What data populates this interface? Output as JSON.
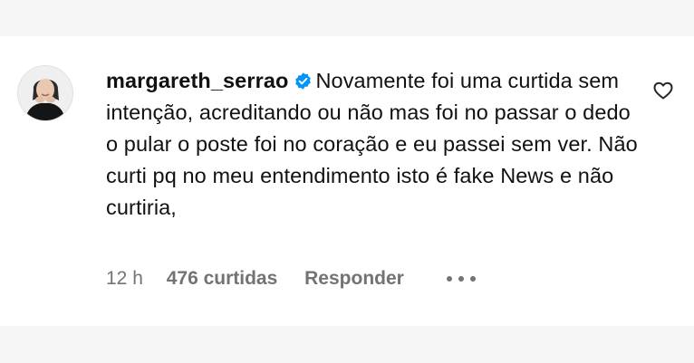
{
  "comment": {
    "username": "margareth_serrao",
    "verified": true,
    "text": "Novamente foi uma curtida sem intenção, acreditando ou não mas foi no passar o dedo o pular o poste foi no coração e eu passei sem ver. Não curti pq no meu entendimento isto é fake News e não curtiria,",
    "time": "12 h",
    "likes": "476 curtidas",
    "reply_label": "Responder"
  },
  "icons": {
    "verified": "verified-badge-icon",
    "like": "heart-outline-icon",
    "more": "more-options-icon",
    "avatar": "profile-avatar"
  },
  "colors": {
    "text": "#111111",
    "muted": "#737373",
    "verified": "#0095f6",
    "background": "#ffffff",
    "gap": "#f6f6f6"
  }
}
